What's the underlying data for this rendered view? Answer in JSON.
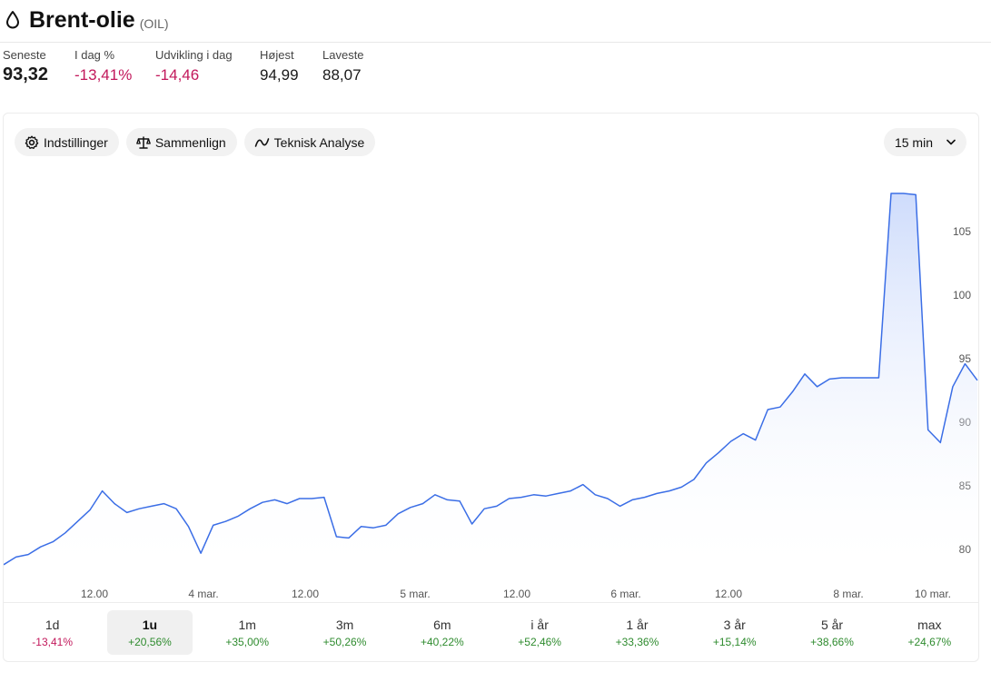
{
  "header": {
    "title": "Brent-olie",
    "ticker": "(OIL)"
  },
  "stats": [
    {
      "label": "Seneste",
      "value": "93,32",
      "tone": "normal"
    },
    {
      "label": "I dag %",
      "value": "-13,41%",
      "tone": "neg"
    },
    {
      "label": "Udvikling i dag",
      "value": "-14,46",
      "tone": "neg"
    },
    {
      "label": "Højest",
      "value": "94,99",
      "tone": "normal"
    },
    {
      "label": "Laveste",
      "value": "88,07",
      "tone": "normal"
    }
  ],
  "toolbar": {
    "settings_label": "Indstillinger",
    "compare_label": "Sammenlign",
    "technical_label": "Teknisk Analyse",
    "interval_label": "15 min"
  },
  "colors": {
    "line": "#3b6ee6",
    "fill_top": "#c9d8fb",
    "negative": "#c2185b",
    "positive": "#2e8b2e"
  },
  "chart_data": {
    "type": "area",
    "ylim": [
      77.5,
      110
    ],
    "y_ticks": [
      "80",
      "85",
      "90",
      "95",
      "100",
      "105"
    ],
    "x_ticks": [
      "12.00",
      "4 mar.",
      "12.00",
      "5 mar.",
      "12.00",
      "6 mar.",
      "12.00",
      "8 mar.",
      "10 mar."
    ],
    "series": [
      {
        "points": [
          [
            0,
            78.8
          ],
          [
            1,
            79.4
          ],
          [
            2,
            79.6
          ],
          [
            3,
            80.2
          ],
          [
            4,
            80.6
          ],
          [
            5,
            81.3
          ],
          [
            6,
            82.2
          ],
          [
            7,
            83.1
          ],
          [
            8,
            84.6
          ],
          [
            9,
            83.6
          ],
          [
            10,
            82.9
          ],
          [
            11,
            83.2
          ],
          [
            12,
            83.4
          ],
          [
            13,
            83.6
          ],
          [
            14,
            83.2
          ],
          [
            15,
            81.8
          ],
          [
            16,
            79.7
          ],
          [
            17,
            81.9
          ],
          [
            18,
            82.2
          ],
          [
            19,
            82.6
          ],
          [
            20,
            83.2
          ],
          [
            21,
            83.7
          ],
          [
            22,
            83.9
          ],
          [
            23,
            83.6
          ],
          [
            24,
            84.0
          ],
          [
            25,
            84.0
          ],
          [
            26,
            84.1
          ],
          [
            27,
            81.0
          ],
          [
            28,
            80.9
          ],
          [
            29,
            81.8
          ],
          [
            30,
            81.7
          ],
          [
            31,
            81.9
          ],
          [
            32,
            82.8
          ],
          [
            33,
            83.3
          ],
          [
            34,
            83.6
          ],
          [
            35,
            84.3
          ],
          [
            36,
            83.9
          ],
          [
            37,
            83.8
          ],
          [
            38,
            82.0
          ],
          [
            39,
            83.2
          ],
          [
            40,
            83.4
          ],
          [
            41,
            84.0
          ],
          [
            42,
            84.1
          ],
          [
            43,
            84.3
          ],
          [
            44,
            84.2
          ],
          [
            45,
            84.4
          ],
          [
            46,
            84.6
          ],
          [
            47,
            85.1
          ],
          [
            48,
            84.3
          ],
          [
            49,
            84.0
          ],
          [
            50,
            83.4
          ],
          [
            51,
            83.9
          ],
          [
            52,
            84.1
          ],
          [
            53,
            84.4
          ],
          [
            54,
            84.6
          ],
          [
            55,
            84.9
          ],
          [
            56,
            85.5
          ],
          [
            57,
            86.8
          ],
          [
            58,
            87.6
          ],
          [
            59,
            88.5
          ],
          [
            60,
            89.1
          ],
          [
            61,
            88.6
          ],
          [
            62,
            91.0
          ],
          [
            63,
            91.2
          ],
          [
            64,
            92.4
          ],
          [
            65,
            93.8
          ],
          [
            66,
            92.8
          ],
          [
            67,
            93.4
          ],
          [
            68,
            93.5
          ],
          [
            69,
            93.5
          ],
          [
            70,
            93.5
          ],
          [
            71,
            93.5
          ],
          [
            72,
            108.0
          ],
          [
            73,
            108.0
          ],
          [
            74,
            107.9
          ],
          [
            75,
            89.4
          ],
          [
            76,
            88.4
          ],
          [
            77,
            92.8
          ],
          [
            78,
            94.6
          ],
          [
            79,
            93.3
          ]
        ]
      }
    ]
  },
  "periods": [
    {
      "label": "1d",
      "change": "-13,41%",
      "tone": "neg",
      "active": false
    },
    {
      "label": "1u",
      "change": "+20,56%",
      "tone": "pos",
      "active": true
    },
    {
      "label": "1m",
      "change": "+35,00%",
      "tone": "pos",
      "active": false
    },
    {
      "label": "3m",
      "change": "+50,26%",
      "tone": "pos",
      "active": false
    },
    {
      "label": "6m",
      "change": "+40,22%",
      "tone": "pos",
      "active": false
    },
    {
      "label": "i år",
      "change": "+52,46%",
      "tone": "pos",
      "active": false
    },
    {
      "label": "1 år",
      "change": "+33,36%",
      "tone": "pos",
      "active": false
    },
    {
      "label": "3 år",
      "change": "+15,14%",
      "tone": "pos",
      "active": false
    },
    {
      "label": "5 år",
      "change": "+38,66%",
      "tone": "pos",
      "active": false
    },
    {
      "label": "max",
      "change": "+24,67%",
      "tone": "pos",
      "active": false
    }
  ]
}
